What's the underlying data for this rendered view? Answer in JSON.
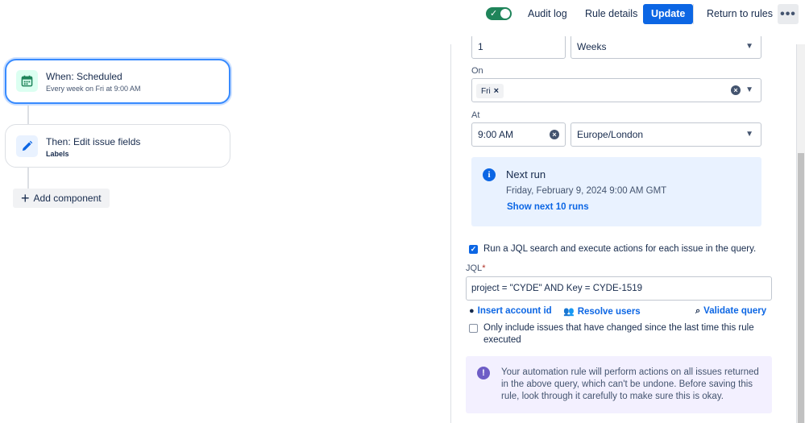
{
  "toolbar": {
    "rule_enabled": true,
    "audit_log": "Audit log",
    "rule_details": "Rule details",
    "update": "Update",
    "return_to_rules": "Return to rules",
    "more": "•••"
  },
  "flow": {
    "trigger": {
      "title": "When: Scheduled",
      "subtitle": "Every week on Fri at 9:00 AM",
      "icon": "calendar-icon"
    },
    "action": {
      "title": "Then: Edit issue fields",
      "subtitle": "Labels",
      "icon": "pencil-icon"
    },
    "add_component": "Add component"
  },
  "panel": {
    "interval_value": "1",
    "interval_unit": "Weeks",
    "on_label": "On",
    "on_days": [
      "Fri"
    ],
    "at_label": "At",
    "at_time": "9:00 AM",
    "timezone": "Europe/London",
    "next_run": {
      "title": "Next run",
      "date": "Friday, February 9, 2024 9:00 AM GMT",
      "link": "Show next 10 runs"
    },
    "run_jql": {
      "checked": true,
      "label": "Run a JQL search and execute actions for each issue in the query."
    },
    "jql_label": "JQL",
    "jql_required": "*",
    "jql_value": "project = \"CYDE\" AND Key = CYDE-1519",
    "actions": {
      "insert_account_id": "Insert account id",
      "resolve_users": "Resolve users",
      "validate_query": "Validate query"
    },
    "only_changed": {
      "checked": false,
      "label_line1": "Only include issues that have changed since the last time this rule",
      "label_line2": "executed"
    },
    "warning": "Your automation rule will perform actions on all issues returned in the above query, which can't be undone. Before saving this rule, look through it carefully to make sure this is okay."
  },
  "colors": {
    "primary": "#0c66e4",
    "toggle_on": "#1f845a",
    "trigger_icon": "#1f845a",
    "action_icon": "#0c66e4",
    "info_bg": "#e9f2ff",
    "warning_bg": "#f3f0ff",
    "warning_icon": "#6e5dc6"
  }
}
